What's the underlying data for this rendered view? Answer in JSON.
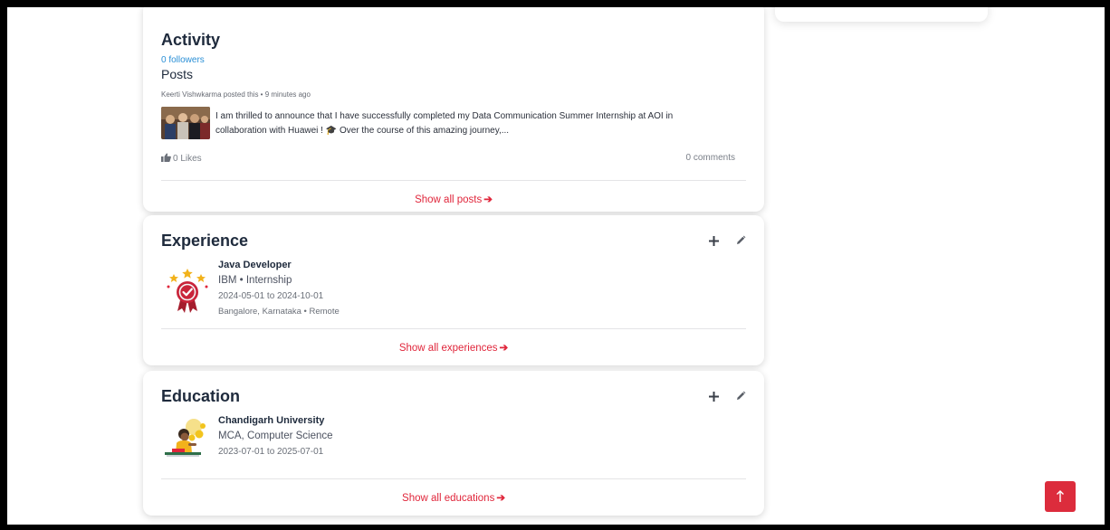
{
  "colors": {
    "accent": "#e0263b",
    "link": "#2a8fd6",
    "title": "#1e2a3c",
    "scroll_button": "#dc2c3c"
  },
  "activity": {
    "title": "Activity",
    "followers": "0 followers",
    "posts_heading": "Posts",
    "post": {
      "meta": "Keerti Vishwkarma posted this • 9 minutes ago",
      "text_line1": "I am thrilled to announce that I have successfully completed my Data Communication Summer Internship at AOI in",
      "text_line2": "collaboration with Huawei ! 🎓 Over the course of this amazing journey,...",
      "likes": "0 Likes",
      "comments": "0 comments"
    },
    "show_all": "Show all posts"
  },
  "experience": {
    "title": "Experience",
    "items": [
      {
        "role": "Java Developer",
        "company": "IBM • Internship",
        "dates": "2024-05-01 to 2024-10-01",
        "location": "Bangalore, Karnataka • Remote",
        "logo_icon": "award-badge-icon"
      }
    ],
    "show_all": "Show all experiences"
  },
  "education": {
    "title": "Education",
    "items": [
      {
        "school": "Chandigarh University",
        "degree": "MCA, Computer Science",
        "dates": "2023-07-01 to 2025-07-01",
        "logo_icon": "student-illustration-icon"
      }
    ],
    "show_all": "Show all educations"
  },
  "icons": {
    "add": "plus-icon",
    "edit": "pencil-icon",
    "like": "thumbs-up-icon",
    "arrow": "arrow-right-icon",
    "scroll_top": "arrow-up-icon"
  }
}
